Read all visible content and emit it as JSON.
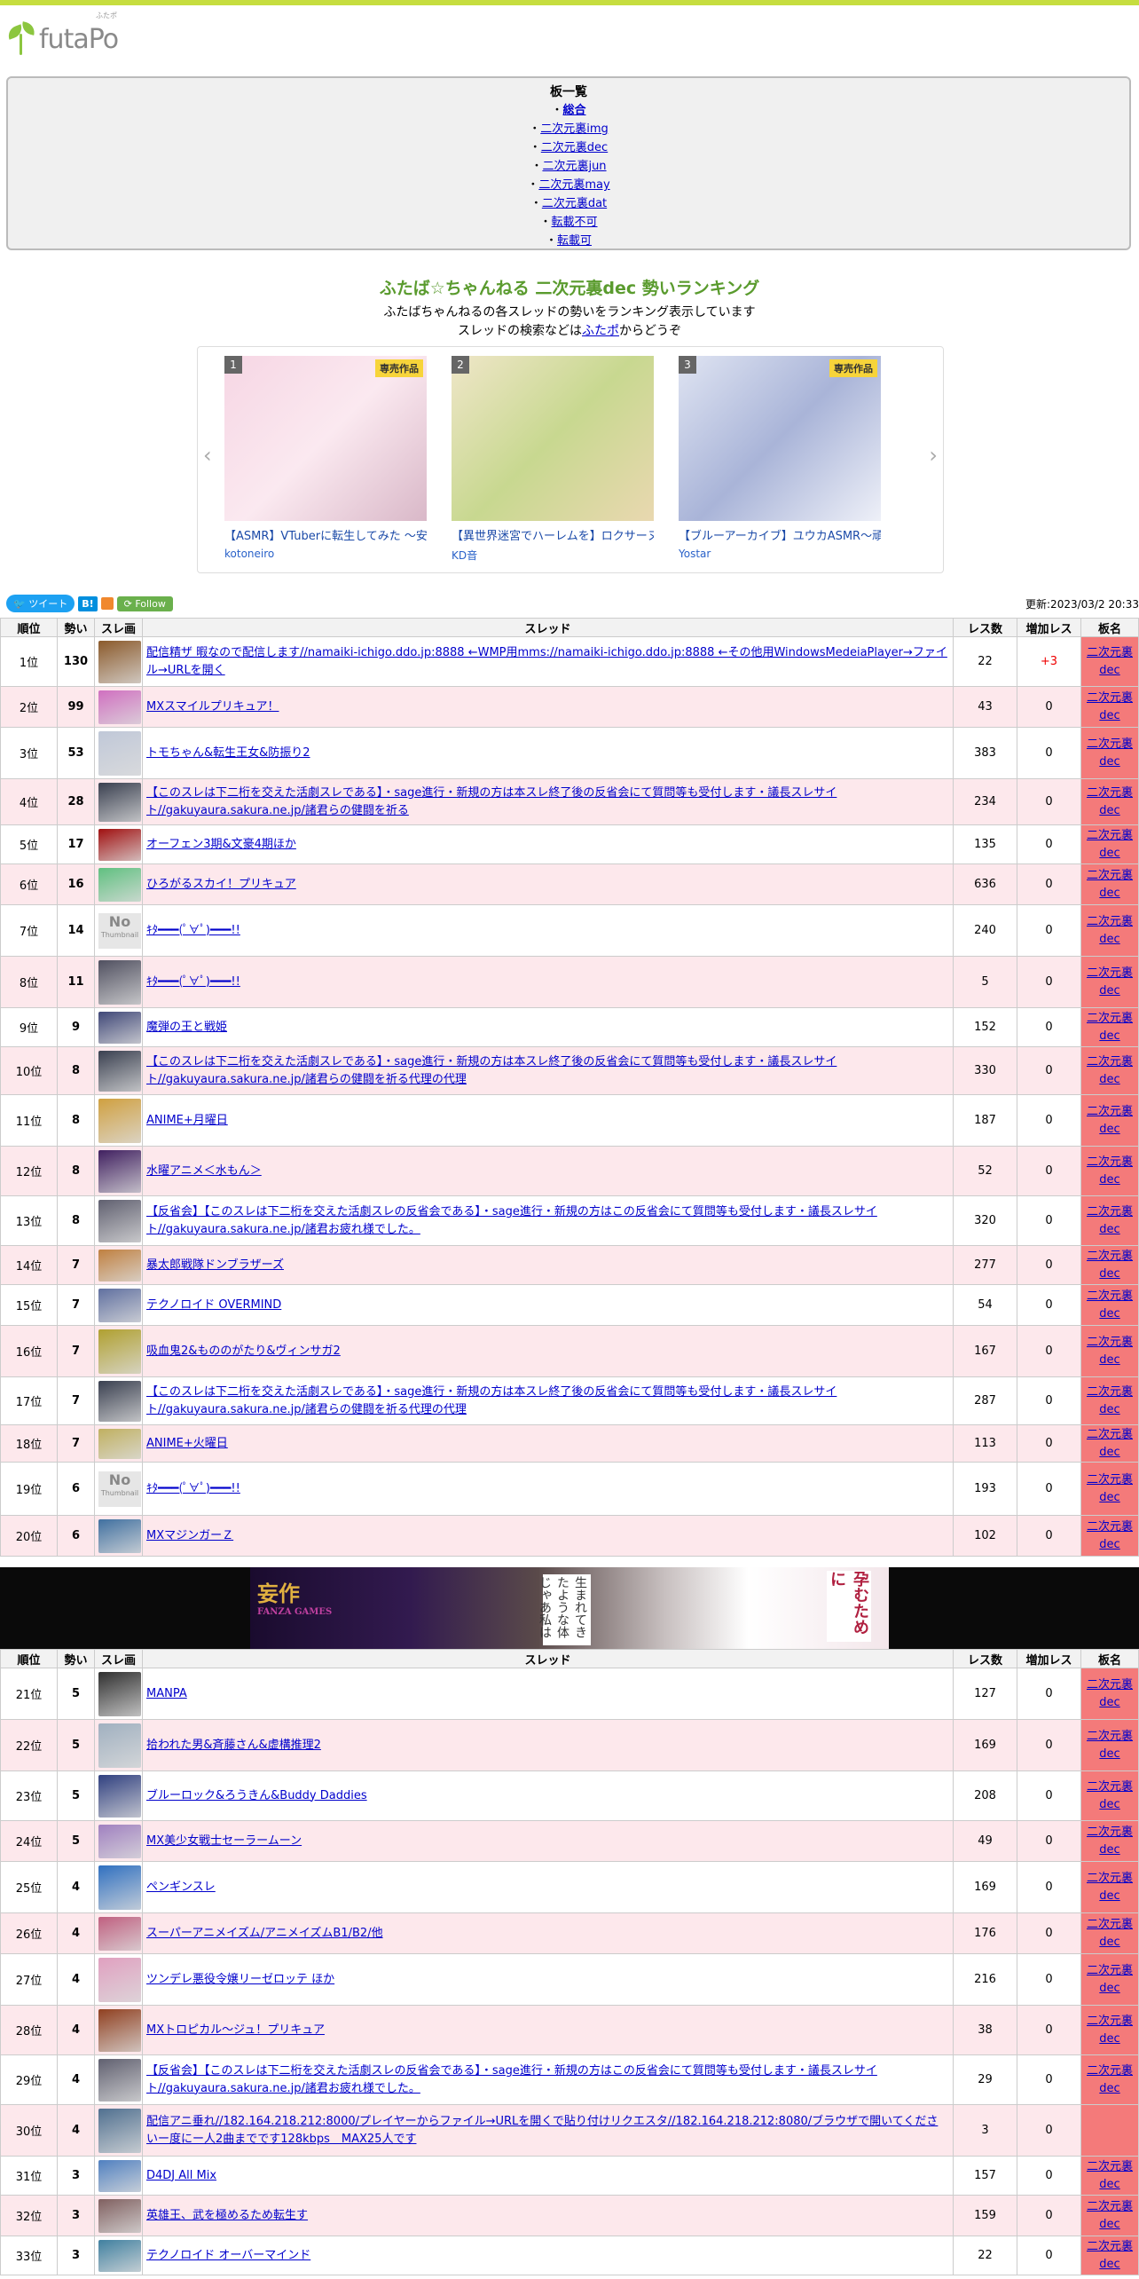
{
  "site": {
    "logo_text": "futaPo",
    "logo_sub": "ふたポ"
  },
  "boards": {
    "title": "板一覧",
    "items": [
      {
        "label": "総合",
        "active": true
      },
      {
        "label": "二次元裏img"
      },
      {
        "label": "二次元裏dec"
      },
      {
        "label": "二次元裏jun"
      },
      {
        "label": "二次元裏may"
      },
      {
        "label": "二次元裏dat"
      },
      {
        "label": "転載不可"
      },
      {
        "label": "転載可"
      }
    ]
  },
  "heading": {
    "title": "ふたば☆ちゃんねる 二次元裏dec 勢いランキング",
    "desc1": "ふたばちゃんねるの各スレッドの勢いをランキング表示しています",
    "desc2_pre": "スレッドの検索などは",
    "desc2_link": "ふたポ",
    "desc2_post": "からどうぞ"
  },
  "carousel": [
    {
      "num": "1",
      "badge": "専売作品",
      "title": "【ASMR】VTuberに転生してみた 〜安済",
      "author": "kotoneiro"
    },
    {
      "num": "2",
      "badge": "",
      "title": "【異世界迷宮でハーレムを】ロクサーヌA",
      "author": "KD音"
    },
    {
      "num": "3",
      "badge": "専売作品",
      "title": "【ブルーアーカイブ】ユウカASMR～頑張",
      "author": "Yostar"
    }
  ],
  "social": {
    "tweet": "ツイート",
    "hatena": "B!",
    "follow": "Follow"
  },
  "updated": "更新:2023/03/2 20:33",
  "table_headers": {
    "rank": "順位",
    "ikioi": "勢い",
    "thumb": "スレ画",
    "thread": "スレッド",
    "res": "レス数",
    "inc": "増加レス",
    "board": "板名"
  },
  "rows_a": [
    {
      "rank": "1位",
      "ikioi": "130",
      "thread": "配信精ザ 暇なので配信します//namaiki-ichigo.ddo.jp:8888 ←WMP用mms://namaiki-ichigo.ddo.jp:8888 ←その他用WindowsMedeiaPlayer→ファイル→URLを開く",
      "res": "22",
      "inc": "+3",
      "board1": "二次元裏",
      "board2": "dec",
      "thumb": "#8b5a2b",
      "h": 56
    },
    {
      "rank": "2位",
      "ikioi": "99",
      "thread": "MXスマイルプリキュア！",
      "res": "43",
      "inc": "0",
      "board1": "二次元裏",
      "board2": "dec",
      "thumb": "#d070c0",
      "h": 46
    },
    {
      "rank": "3位",
      "ikioi": "53",
      "thread": "トモちゃん&転生王女&防振り2",
      "res": "383",
      "inc": "0",
      "board1": "二次元裏",
      "board2": "dec",
      "thumb": "#c0c8d8",
      "h": 58
    },
    {
      "rank": "4位",
      "ikioi": "28",
      "thread": "【このスレは下二桁を交えた活劇スレである】・sage進行・新規の方は本スレ終了後の反省会にて質問等も受付します・議長スレサイト//gakuyaura.sakura.ne.jp/諸君らの健闘を祈る",
      "res": "234",
      "inc": "0",
      "board1": "二次元裏",
      "board2": "dec",
      "thumb": "#3a4050",
      "h": 52
    },
    {
      "rank": "5位",
      "ikioi": "17",
      "thread": "オーフェン3期&文豪4期ほか",
      "res": "135",
      "inc": "0",
      "board1": "二次元裏",
      "board2": "dec",
      "thumb": "#a01010",
      "h": 44
    },
    {
      "rank": "6位",
      "ikioi": "16",
      "thread": "ひろがるスカイ！プリキュア",
      "res": "636",
      "inc": "0",
      "board1": "二次元裏",
      "board2": "dec",
      "thumb": "#60c080",
      "h": 46
    },
    {
      "rank": "7位",
      "ikioi": "14",
      "thread": "ｷﾀ━━━(ﾟ∀ﾟ)━━━!!",
      "res": "240",
      "inc": "0",
      "board1": "二次元裏",
      "board2": "dec",
      "thumb": "",
      "h": 58
    },
    {
      "rank": "8位",
      "ikioi": "11",
      "thread": "ｷﾀ━━━(ﾟ∀ﾟ)━━━!!",
      "res": "5",
      "inc": "0",
      "board1": "二次元裏",
      "board2": "dec",
      "thumb": "#505060",
      "h": 58
    },
    {
      "rank": "9位",
      "ikioi": "9",
      "thread": "魔弾の王と戦姫",
      "res": "152",
      "inc": "0",
      "board1": "二次元裏",
      "board2": "dec",
      "thumb": "#404878",
      "h": 44
    },
    {
      "rank": "10位",
      "ikioi": "8",
      "thread": "【このスレは下二桁を交えた活劇スレである】・sage進行・新規の方は本スレ終了後の反省会にて質問等も受付します・議長スレサイト//gakuyaura.sakura.ne.jp/諸君らの健闘を祈る代理の代理",
      "res": "330",
      "inc": "0",
      "board1": "二次元裏",
      "board2": "dec",
      "thumb": "#3a4050",
      "h": 54
    },
    {
      "rank": "11位",
      "ikioi": "8",
      "thread": "ANIME+月曜日",
      "res": "187",
      "inc": "0",
      "board1": "二次元裏",
      "board2": "dec",
      "thumb": "#d0a040",
      "h": 58
    },
    {
      "rank": "12位",
      "ikioi": "8",
      "thread": "水曜アニメ＜水もん＞",
      "res": "52",
      "inc": "0",
      "board1": "二次元裏",
      "board2": "dec",
      "thumb": "#402060",
      "h": 56
    },
    {
      "rank": "13位",
      "ikioi": "8",
      "thread": "【反省会】【このスレは下二桁を交えた活劇スレの反省会である】・sage進行・新規の方はこの反省会にて質問等も受付します・議長スレサイト//gakuyaura.sakura.ne.jp/諸君お疲れ様でした。",
      "res": "320",
      "inc": "0",
      "board1": "二次元裏",
      "board2": "dec",
      "thumb": "#606070",
      "h": 56
    },
    {
      "rank": "14位",
      "ikioi": "7",
      "thread": "暴太郎戦隊ドンブラザーズ",
      "res": "277",
      "inc": "0",
      "board1": "二次元裏",
      "board2": "dec",
      "thumb": "#c08040",
      "h": 44
    },
    {
      "rank": "15位",
      "ikioi": "7",
      "thread": "テクノロイド OVERMIND",
      "res": "54",
      "inc": "0",
      "board1": "二次元裏",
      "board2": "dec",
      "thumb": "#6070a0",
      "h": 46
    },
    {
      "rank": "16位",
      "ikioi": "7",
      "thread": "吸血鬼2&もののがたり&ヴィンサガ2",
      "res": "167",
      "inc": "0",
      "board1": "二次元裏",
      "board2": "dec",
      "thumb": "#b0a030",
      "h": 58
    },
    {
      "rank": "17位",
      "ikioi": "7",
      "thread": "【このスレは下二桁を交えた活劇スレである】・sage進行・新規の方は本スレ終了後の反省会にて質問等も受付します・議長スレサイト//gakuyaura.sakura.ne.jp/諸君らの健闘を祈る代理の代理",
      "res": "287",
      "inc": "0",
      "board1": "二次元裏",
      "board2": "dec",
      "thumb": "#3a4050",
      "h": 54
    },
    {
      "rank": "18位",
      "ikioi": "7",
      "thread": "ANIME+火曜日",
      "res": "113",
      "inc": "0",
      "board1": "二次元裏",
      "board2": "dec",
      "thumb": "#c0b060",
      "h": 42
    },
    {
      "rank": "19位",
      "ikioi": "6",
      "thread": "ｷﾀ━━━(ﾟ∀ﾟ)━━━!!",
      "res": "193",
      "inc": "0",
      "board1": "二次元裏",
      "board2": "dec",
      "thumb": "",
      "h": 60
    },
    {
      "rank": "20位",
      "ikioi": "6",
      "thread": "MXマジンガーＺ",
      "res": "102",
      "inc": "0",
      "board1": "二次元裏",
      "board2": "dec",
      "thumb": "#4070a0",
      "h": 46
    }
  ],
  "banner": {
    "logo": "妄作",
    "logo_sub": "FANZA GAMES",
    "text1": "生まれてきたような体じゃあ私は",
    "text2": "孕むために"
  },
  "rows_b": [
    {
      "rank": "21位",
      "ikioi": "5",
      "thread": "MANPA",
      "res": "127",
      "inc": "0",
      "board1": "二次元裏",
      "board2": "dec",
      "thumb": "#303030",
      "h": 58
    },
    {
      "rank": "22位",
      "ikioi": "5",
      "thread": "拾われた男&斉藤さん&虚構推理2",
      "res": "169",
      "inc": "0",
      "board1": "二次元裏",
      "board2": "dec",
      "thumb": "#a0b0c0",
      "h": 58
    },
    {
      "rank": "23位",
      "ikioi": "5",
      "thread": "ブルーロック&ろうきん&Buddy Daddies",
      "res": "208",
      "inc": "0",
      "board1": "二次元裏",
      "board2": "dec",
      "thumb": "#304080",
      "h": 56
    },
    {
      "rank": "24位",
      "ikioi": "5",
      "thread": "MX美少女戦士セーラームーン",
      "res": "49",
      "inc": "0",
      "board1": "二次元裏",
      "board2": "dec",
      "thumb": "#a080c0",
      "h": 46
    },
    {
      "rank": "25位",
      "ikioi": "4",
      "thread": "ペンギンスレ",
      "res": "169",
      "inc": "0",
      "board1": "二次元裏",
      "board2": "dec",
      "thumb": "#3070c0",
      "h": 58
    },
    {
      "rank": "26位",
      "ikioi": "4",
      "thread": "スーパーアニメイズム/アニメイズムB1/B2/他",
      "res": "176",
      "inc": "0",
      "board1": "二次元裏",
      "board2": "dec",
      "thumb": "#c06080",
      "h": 46
    },
    {
      "rank": "27位",
      "ikioi": "4",
      "thread": "ツンデレ悪役令嬢リーゼロッテ ほか",
      "res": "216",
      "inc": "0",
      "board1": "二次元裏",
      "board2": "dec",
      "thumb": "#e0a0c0",
      "h": 58
    },
    {
      "rank": "28位",
      "ikioi": "4",
      "thread": "MXトロピカル～ジュ！プリキュア",
      "res": "38",
      "inc": "0",
      "board1": "二次元裏",
      "board2": "dec",
      "thumb": "#904020",
      "h": 56
    },
    {
      "rank": "29位",
      "ikioi": "4",
      "thread": "【反省会】【このスレは下二桁を交えた活劇スレの反省会である】・sage進行・新規の方はこの反省会にて質問等も受付します・議長スレサイト//gakuyaura.sakura.ne.jp/諸君お疲れ様でした。",
      "res": "29",
      "inc": "0",
      "board1": "二次元裏",
      "board2": "dec",
      "thumb": "#606070",
      "h": 56
    },
    {
      "rank": "30位",
      "ikioi": "4",
      "thread": "配信アニ垂れ//182.164.218.212:8000/プレイヤーからファイル→URLを開くで貼り付けリクエスタ//182.164.218.212:8080/ブラウザで開いてくださいー度にー人2曲までです128kbps　MAX25人です",
      "res": "3",
      "inc": "0",
      "board1": "",
      "board2": "",
      "thumb": "#507090",
      "h": 58
    },
    {
      "rank": "31位",
      "ikioi": "3",
      "thread": "D4DJ All Mix",
      "res": "157",
      "inc": "0",
      "board1": "二次元裏",
      "board2": "dec",
      "thumb": "#5080c0",
      "h": 44
    },
    {
      "rank": "32位",
      "ikioi": "3",
      "thread": "英雄王、武を極めるため転生す",
      "res": "159",
      "inc": "0",
      "board1": "二次元裏",
      "board2": "dec",
      "thumb": "#806060",
      "h": 46
    },
    {
      "rank": "33位",
      "ikioi": "3",
      "thread": "テクノロイド オーバーマインド",
      "res": "22",
      "inc": "0",
      "board1": "二次元裏",
      "board2": "dec",
      "thumb": "#4080a0",
      "h": 44
    }
  ]
}
